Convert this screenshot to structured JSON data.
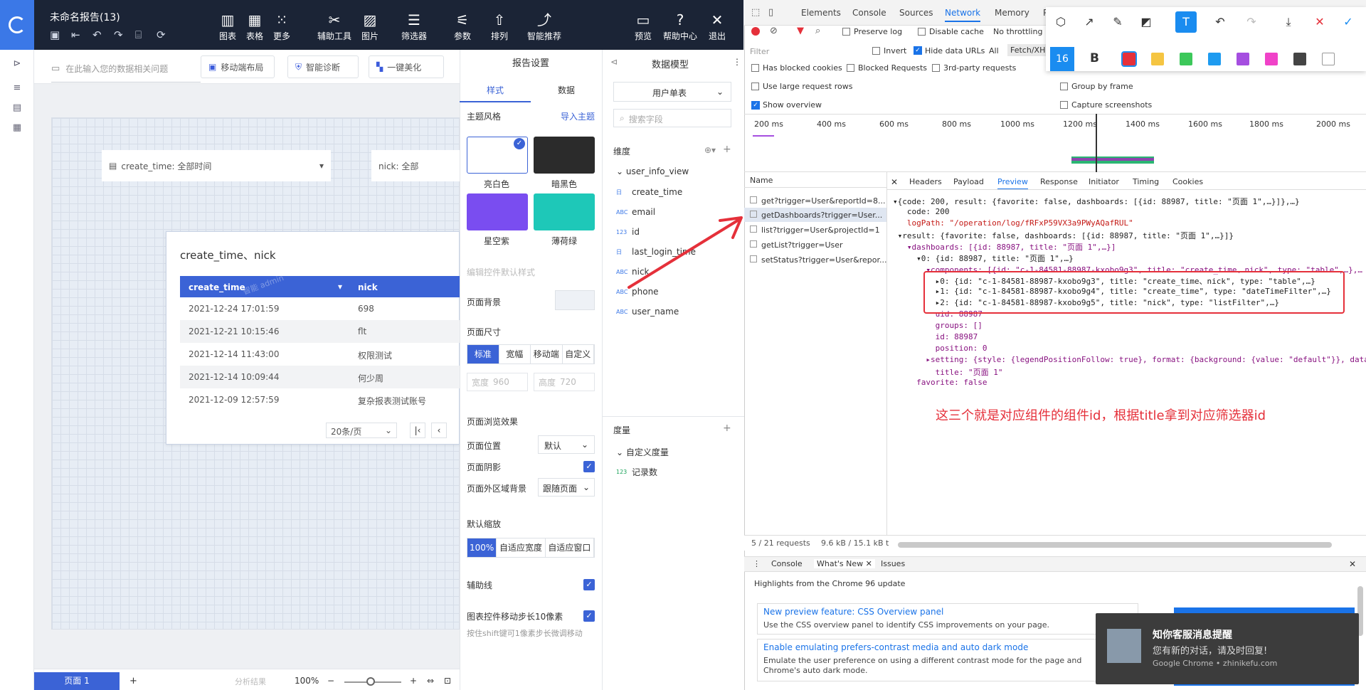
{
  "app": {
    "doc_title": "未命名报告(13)",
    "toolbar": [
      {
        "label": "图表",
        "icon": "bar-chart-icon"
      },
      {
        "label": "表格",
        "icon": "table-icon"
      },
      {
        "label": "更多",
        "icon": "grid-icon"
      },
      {
        "label": "辅助工具",
        "icon": "tools-icon"
      },
      {
        "label": "图片",
        "icon": "image-icon"
      },
      {
        "label": "筛选器",
        "icon": "filter-list-icon"
      },
      {
        "label": "参数",
        "icon": "params-icon"
      },
      {
        "label": "排列",
        "icon": "arrange-icon"
      },
      {
        "label": "智能推荐",
        "icon": "smart-chart-icon"
      },
      {
        "label": "预览",
        "icon": "preview-icon"
      },
      {
        "label": "帮助中心",
        "icon": "help-icon"
      },
      {
        "label": "退出",
        "icon": "close-icon"
      }
    ],
    "search_placeholder": "在此输入您的数据相关问题",
    "pills": [
      "移动端布局",
      "智能诊断",
      "一键美化"
    ],
    "filters": [
      {
        "label": "create_time: 全部时间"
      },
      {
        "label": "nick: 全部"
      }
    ],
    "table": {
      "title": "create_time、nick",
      "columns": [
        "create_time",
        "nick"
      ],
      "watermark": "智能 admin",
      "rows": [
        [
          "2021-12-24 17:01:59",
          "698"
        ],
        [
          "2021-12-21 10:15:46",
          "flt"
        ],
        [
          "2021-12-14 11:43:00",
          "权限测试"
        ],
        [
          "2021-12-14 10:09:44",
          "何少周"
        ],
        [
          "2021-12-09 12:57:59",
          "复杂报表测试账号"
        ]
      ],
      "page_size": "20条/页"
    },
    "bottom": {
      "page_tab": "页面 1",
      "add": "+",
      "analysis": "分析结果",
      "zoom": "100%"
    }
  },
  "settings": {
    "header": "报告设置",
    "tabs": [
      "样式",
      "数据"
    ],
    "theme_section": "主题风格",
    "import_theme": "导入主题",
    "themes": [
      {
        "name": "亮白色",
        "color": "#ffffff"
      },
      {
        "name": "暗黑色",
        "color": "#2b2b2b"
      },
      {
        "name": "星空紫",
        "color": "#7a4df0"
      },
      {
        "name": "薄荷绿",
        "color": "#1ec8b8"
      }
    ],
    "edit_default": "编辑控件默认样式",
    "page_bg": "页面背景",
    "page_size_section": "页面尺寸",
    "size_options": [
      "标准",
      "宽幅",
      "移动端",
      "自定义"
    ],
    "width_label": "宽度",
    "width_value": "960",
    "height_label": "高度",
    "height_value": "720",
    "browse_section": "页面浏览效果",
    "page_position": "页面位置",
    "page_position_value": "默认",
    "page_shadow": "页面阴影",
    "outer_bg": "页面外区域背景",
    "outer_bg_value": "跟随页面",
    "zoom_section": "默认缩放",
    "zoom_options": [
      "100%",
      "自适应宽度",
      "自适应窗口"
    ],
    "guides": "辅助线",
    "step": "图表控件移动步长10像素",
    "step_hint": "按住shift键可1像素步长微调移动"
  },
  "model": {
    "header": "数据模型",
    "table_select": "用户单表",
    "search_placeholder": "搜索字段",
    "dims_label": "维度",
    "view_name": "user_info_view",
    "fields": [
      {
        "type": "日",
        "name": "create_time"
      },
      {
        "type": "ABC",
        "name": "email"
      },
      {
        "type": "123",
        "name": "id"
      },
      {
        "type": "日",
        "name": "last_login_time"
      },
      {
        "type": "ABC",
        "name": "nick"
      },
      {
        "type": "ABC",
        "name": "phone"
      },
      {
        "type": "ABC",
        "name": "user_name"
      }
    ],
    "measures_label": "度量",
    "custom_measure": "自定义度量",
    "record_count": "记录数"
  },
  "devtools": {
    "tabs": [
      "Elements",
      "Console",
      "Sources",
      "Network",
      "Memory",
      "Pe"
    ],
    "preserve_log": "Preserve log",
    "disable_cache": "Disable cache",
    "no_throttling": "No throttling",
    "filter_placeholder": "Filter",
    "invert": "Invert",
    "hide_data_urls": "Hide data URLs",
    "all": "All",
    "fetch_xhr": "Fetch/XHR",
    "has_blocked_cookies": "Has blocked cookies",
    "blocked_requests": "Blocked Requests",
    "third_party": "3rd-party requests",
    "large_rows": "Use large request rows",
    "group_by_frame": "Group by frame",
    "show_overview": "Show overview",
    "capture_screenshots": "Capture screenshots",
    "timeline_ticks": [
      "200 ms",
      "400 ms",
      "600 ms",
      "800 ms",
      "1000 ms",
      "1200 ms",
      "1400 ms",
      "1600 ms",
      "1800 ms",
      "2000 ms"
    ],
    "name_header": "Name",
    "requests": [
      "get?trigger=User&reportId=8...",
      "getDashboards?trigger=User...",
      "list?trigger=User&projectId=1",
      "getList?trigger=User",
      "setStatus?trigger=User&repor..."
    ],
    "detail_tabs": [
      "Headers",
      "Payload",
      "Preview",
      "Response",
      "Initiator",
      "Timing",
      "Cookies"
    ],
    "status_requests": "5 / 21 requests",
    "status_size": "9.6 kB / 15.1 kB t",
    "preview_lines": [
      "▾{code: 200, result: {favorite: false, dashboards: [{id: 88987, title: \"页面 1\",…}]},…}",
      "   code: 200",
      "   logPath: \"/operation/log/fRFxP59VX3a9PWyAQafRUL\"",
      " ▾result: {favorite: false, dashboards: [{id: 88987, title: \"页面 1\",…}]}",
      "   ▾dashboards: [{id: 88987, title: \"页面 1\",…}]",
      "     ▾0: {id: 88987, title: \"页面 1\",…}",
      "       ▾components: [{id: \"c-1-84581-88987-kxobo9g3\", title: \"create_time、nick\", type: \"table\",…},…",
      "         ▸0: {id: \"c-1-84581-88987-kxobo9g3\", title: \"create_time、nick\", type: \"table\",…}",
      "         ▸1: {id: \"c-1-84581-88987-kxobo9g4\", title: \"create_time\", type: \"dateTimeFilter\",…}",
      "         ▸2: {id: \"c-1-84581-88987-kxobo9g5\", title: \"nick\", type: \"listFilter\",…}",
      "         uid: 88987",
      "         groups: []",
      "         id: 88987",
      "         position: 0",
      "       ▸setting: {style: {legendPositionFollow: true}, format: {background: {value: \"default\"}}, data",
      "         title: \"页面 1\"",
      "     favorite: false"
    ],
    "annotation": "这三个就是对应组件的组件id，根据title拿到对应筛选器id",
    "drawer_tabs": [
      "Console",
      "What's New",
      "Issues"
    ],
    "highlights": "Highlights from the Chrome 96 update",
    "news": [
      {
        "title": "New preview feature: CSS Overview panel",
        "desc": "Use the CSS overview panel to identify CSS improvements on your page."
      },
      {
        "title": "Enable emulating prefers-contrast media and auto dark mode",
        "desc": "Emulate the user preference on using a different contrast mode for the page and Chrome's auto dark mode."
      }
    ]
  },
  "drawbar": {
    "size": "16",
    "bold": "B",
    "colors": [
      "#e5303a",
      "#f5c542",
      "#3cc85a",
      "#1e9bf0",
      "#a54ee0",
      "#f042c8",
      "#444444",
      "#ffffff"
    ]
  },
  "toast": {
    "title": "知你客服消息提醒",
    "body": "您有新的对话，请及时回复!",
    "source": "Google Chrome • zhinikefu.com"
  }
}
